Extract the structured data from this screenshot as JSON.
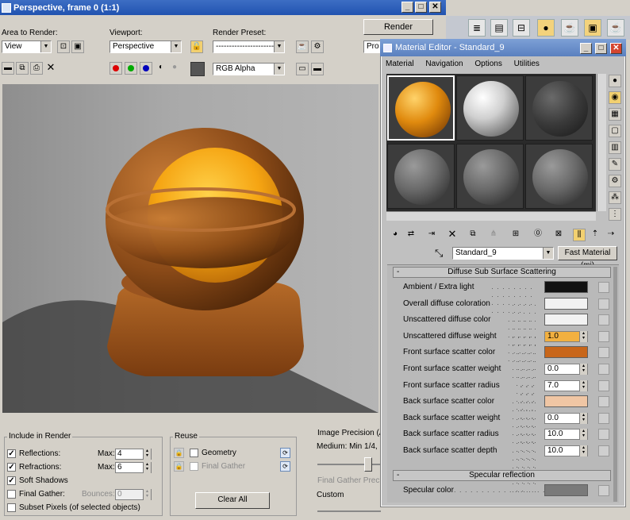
{
  "frame_window": {
    "title": "Perspective, frame 0 (1:1)",
    "controls": [
      "_",
      "□",
      "✕"
    ],
    "area_to_render_label": "Area to Render:",
    "area_to_render_value": "View",
    "viewport_label": "Viewport:",
    "viewport_value": "Perspective",
    "render_preset_label": "Render Preset:",
    "render_preset_value": "-----------------------",
    "render_button": "Render",
    "production_label": "Pro",
    "channel_value": "RGB Alpha"
  },
  "include_in_render": {
    "title": "Include in Render",
    "reflections": "Reflections:",
    "reflections_max_label": "Max:",
    "reflections_max": "4",
    "refractions": "Refractions:",
    "refractions_max_label": "Max:",
    "refractions_max": "6",
    "soft_shadows": "Soft Shadows",
    "final_gather": "Final Gather:",
    "bounces_label": "Bounces:",
    "bounces": "0",
    "subset_pixels": "Subset Pixels (of selected objects)"
  },
  "reuse": {
    "title": "Reuse",
    "geometry": "Geometry",
    "final_gather": "Final Gather",
    "clear_all": "Clear All"
  },
  "image_precision": {
    "title": "Image Precision (A",
    "quality_value": "Medium: Min 1/4, M",
    "fg_precision": "Final Gather Precis",
    "fg_value": "Custom"
  },
  "material_editor": {
    "title": "Material Editor - Standard_9",
    "controls": [
      "_",
      "□",
      "✕"
    ],
    "menu": [
      "Material",
      "Navigation",
      "Options",
      "Utilities"
    ],
    "material_name": "Standard_9",
    "material_type_button": "Fast Material (mi)",
    "rollout_sss": "Diffuse Sub Surface Scattering",
    "rollout_specular": "Specular reflection",
    "params": [
      {
        "label": "Ambient / Extra light",
        "type": "color",
        "color": "#111111"
      },
      {
        "label": "Overall diffuse coloration",
        "type": "color",
        "color": "#f2f2f2"
      },
      {
        "label": "Unscattered diffuse color",
        "type": "color",
        "color": "#f2f2f2"
      },
      {
        "label": "Unscattered diffuse weight",
        "type": "value",
        "value": "1.0"
      },
      {
        "label": "Front surface scatter color",
        "type": "color",
        "color": "#c8661a"
      },
      {
        "label": "Front surface scatter weight",
        "type": "value",
        "value": "0.0"
      },
      {
        "label": "Front surface scatter radius",
        "type": "value",
        "value": "7.0"
      },
      {
        "label": "Back surface scatter color",
        "type": "color",
        "color": "#f0c6a4"
      },
      {
        "label": "Back surface scatter weight",
        "type": "value",
        "value": "0.0"
      },
      {
        "label": "Back surface scatter radius",
        "type": "value",
        "value": "10.0"
      },
      {
        "label": "Back surface scatter depth",
        "type": "value",
        "value": "10.0"
      }
    ],
    "specular_color_label": "Specular color",
    "specular_color": "#7a7a7a"
  }
}
